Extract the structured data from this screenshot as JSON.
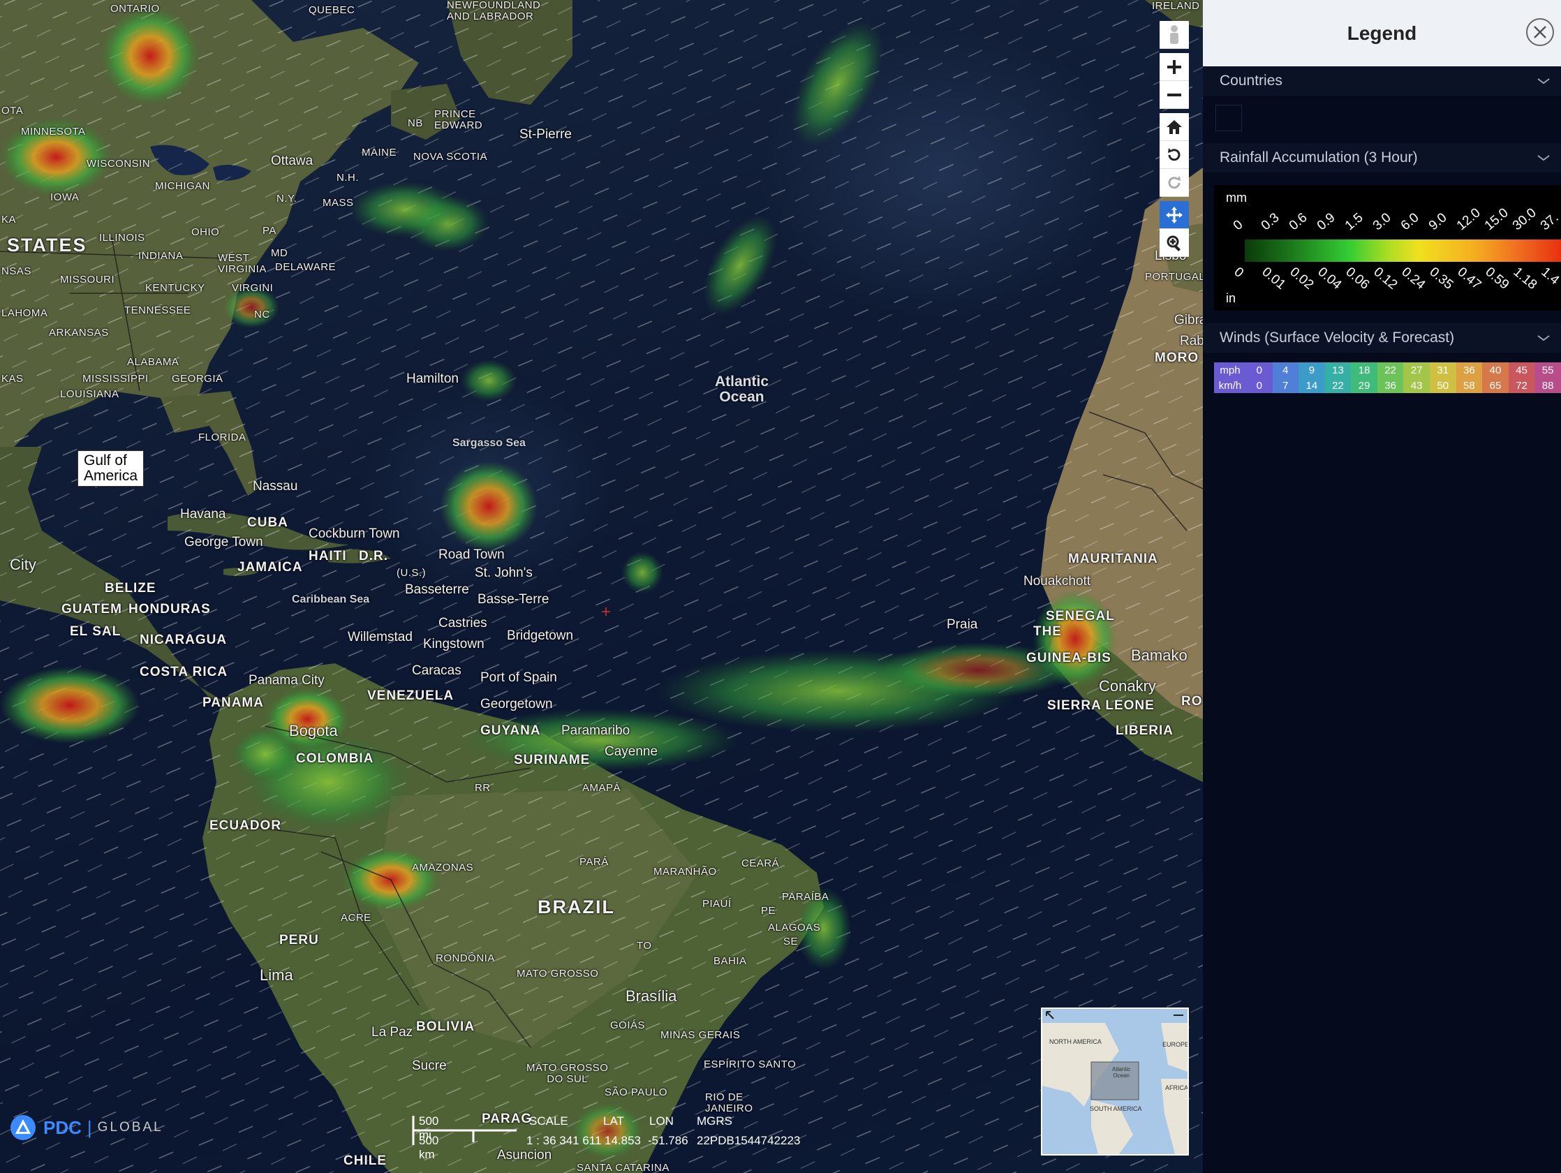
{
  "map": {
    "labels": {
      "ontario": "ONTARIO",
      "quebec": "QUEBEC",
      "newfoundland": "NEWFOUNDLAND\nAND LABRADOR",
      "ireland": "IRELAND",
      "minnesota": "MINNESOTA",
      "wisconsin": "WISCONSIN",
      "michigan": "MICHIGAN",
      "iowa": "IOWA",
      "ottawa": "Ottawa",
      "maine": "MAINE",
      "nb": "NB",
      "pei": "PRINCE\nEDWARD",
      "nova_scotia": "NOVA SCOTIA",
      "st_pierre": "St-Pierre",
      "nh": "N.H.",
      "ny": "N.Y.",
      "mass": "MASS",
      "ohio": "OHIO",
      "pa": "PA",
      "illinois": "ILLINOIS",
      "states": "STATES",
      "nsas": "NSAS",
      "indiana": "INDIANA",
      "west_virginia": "WEST\nVIRGINIA",
      "delaware": "DELAWARE",
      "md": "MD",
      "missouri": "MISSOURI",
      "kentucky": "KENTUCKY",
      "virgini": "VIRGINI",
      "ota": "OTA",
      "ka": "KA",
      "lahoma": "LAHOMA",
      "tennessee": "TENNESSEE",
      "nc": "NC",
      "arkansas": "ARKANSAS",
      "alabama": "ALABAMA",
      "mississippi": "MISSISSIPPI",
      "georgia": "GEORGIA",
      "kas": "KAS",
      "louisiana": "LOUISIANA",
      "florida": "FLORIDA",
      "hamilton": "Hamilton",
      "atlantic": "Atlantic\nOcean",
      "lisbo": "Lisbo",
      "portugal": "PORTUGAL",
      "gibra": "Gibra",
      "rab": "Rab",
      "moro": "MORO",
      "sargasso": "Sargasso Sea",
      "nassau": "Nassau",
      "havana": "Havana",
      "cuba": "CUBA",
      "george_town": "George Town",
      "cockburn": "Cockburn Town",
      "haiti": "HAITI",
      "dr": "D.R.",
      "road_town": "Road Town",
      "city": "City",
      "jamaica": "JAMAICA",
      "st_johns": "St. John's",
      "us": "(U.S.)",
      "belize": "BELIZE",
      "basseterre": "Basseterre",
      "basse_terre": "Basse-Terre",
      "caribbean": "Caribbean Sea",
      "guatemala": "GUATEM",
      "honduras": "HONDURAS",
      "castries": "Castries",
      "el_sal": "EL SAL",
      "nicaragua": "NICARAGUA",
      "bridgetown": "Bridgetown",
      "willemstad": "Willemstad",
      "kingstown": "Kingstown",
      "mauritania": "MAURITANIA",
      "nouakchott": "Nouakchott",
      "senegal": "SENEGAL",
      "the_gambia": "THE",
      "praia": "Praia",
      "costa_rica": "COSTA RICA",
      "caracas": "Caracas",
      "port_of_spain": "Port of Spain",
      "panama_city": "Panama City",
      "panama": "PANAMA",
      "venezuela": "VENEZUELA",
      "guinea_bissau": "GUINEA-BIS",
      "bamako": "Bamako",
      "conakry": "Conakry",
      "georgetown": "Georgetown",
      "sierra_leone": "SIERRA LEONE",
      "bogota": "Bogota",
      "guyana": "GUYANA",
      "paramaribo": "Paramaribo",
      "liberia": "LIBERIA",
      "colombia": "COLOMBIA",
      "suriname": "SURINAME",
      "cayenne": "Cayenne",
      "rr": "RR",
      "amapa": "AMAPÁ",
      "ecuador": "ECUADOR",
      "para": "PARÁ",
      "amazonas": "AMAZONAS",
      "maranhao": "MARANHÃO",
      "ceara": "CEARÁ",
      "piaui": "PIAUÍ",
      "pe": "PE",
      "paraiba": "PARAÍBA",
      "alagoas": "ALAGOAS",
      "se": "SE",
      "brazil": "BRAZIL",
      "acre": "ACRE",
      "to": "TO",
      "peru": "PERU",
      "bahia": "BAHIA",
      "rondonia": "RONDÔNIA",
      "mato_grosso": "MATO GROSSO",
      "lima": "Lima",
      "brasilia": "Brasília",
      "bolivia": "BOLIVIA",
      "goias": "GOIÁS",
      "la_paz": "La Paz",
      "minas": "MINAS GERAIS",
      "sucre": "Sucre",
      "espirito": "ESPÍRITO SANTO",
      "mato_grosso_sul": "MATO GROSSO\nDO SUL",
      "rio": "RIO DE\nJANEIRO",
      "sao_paulo": "SÃO PAULO",
      "paraguay": "PARAG",
      "asuncion": "Asuncion",
      "chile": "CHILE",
      "santa_catarina": "SANTA CATARINA",
      "ro": "RO"
    },
    "gulf_label": "Gulf of\nAmerica",
    "scale": {
      "mi": "500 mi",
      "km": "500 km"
    },
    "coords": {
      "scale_label": "SCALE",
      "scale_value": "1 : 36 341 611",
      "lat_label": "LAT",
      "lat_value": "14.853",
      "lon_label": "LON",
      "lon_value": "-51.786",
      "mgrs_label": "MGRS",
      "mgrs_value": "22PDB1544742223"
    },
    "overview": {
      "north_america": "NORTH AMERICA",
      "europe": "EUROPE",
      "south_america": "SOUTH AMERICA",
      "africa": "AFRICA",
      "atlantic": "Atlantic\nOcean"
    },
    "logo": {
      "pdc": "PDC",
      "global": "GLOBAL"
    }
  },
  "toolbar": [
    "person-icon",
    "zoom-in-icon",
    "zoom-out-icon",
    "home-icon",
    "rotate-left-icon",
    "rotate-right-icon",
    "pan-icon",
    "magnify-icon"
  ],
  "legend": {
    "title": "Legend",
    "sections": {
      "countries": "Countries",
      "rainfall": "Rainfall Accumulation (3 Hour)",
      "winds": "Winds (Surface Velocity & Forecast)"
    },
    "rainfall": {
      "unit_top": "mm",
      "unit_bottom": "in",
      "mm_ticks": [
        "0",
        "0.3",
        "0.6",
        "0.9",
        "1.5",
        "3.0",
        "6.0",
        "9.0",
        "12.0",
        "15.0",
        "30.0",
        "37."
      ],
      "in_ticks": [
        "0",
        "0.01",
        "0.02",
        "0.04",
        "0.06",
        "0.12",
        "0.24",
        "0.35",
        "0.47",
        "0.59",
        "1.18",
        "1.4"
      ]
    },
    "winds": {
      "mph_label": "mph",
      "kmh_label": "km/h",
      "mph": [
        "0",
        "4",
        "9",
        "13",
        "18",
        "22",
        "27",
        "31",
        "36",
        "40",
        "45",
        "55"
      ],
      "kmh": [
        "0",
        "7",
        "14",
        "22",
        "29",
        "36",
        "43",
        "50",
        "58",
        "65",
        "72",
        "88"
      ],
      "colors": [
        "#6b5bd2",
        "#4f7fd6",
        "#3c9bc8",
        "#36b0a4",
        "#3fbb7a",
        "#6cc35a",
        "#a3c64a",
        "#cfc043",
        "#dda042",
        "#d6794a",
        "#c9575e",
        "#b84d8a"
      ]
    }
  }
}
